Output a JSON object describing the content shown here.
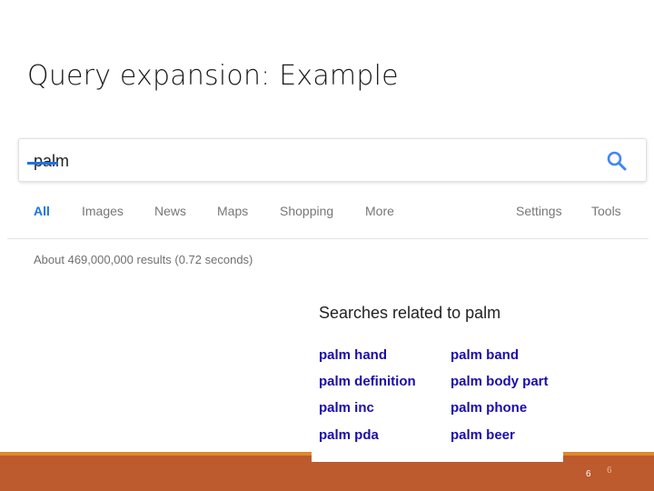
{
  "slide": {
    "title": "Query expansion: Example",
    "number": "6",
    "number_ghost": "6"
  },
  "search": {
    "query": "palm",
    "button_icon": "search-icon"
  },
  "tabs": [
    {
      "label": "All",
      "active": true
    },
    {
      "label": "Images"
    },
    {
      "label": "News"
    },
    {
      "label": "Maps"
    },
    {
      "label": "Shopping"
    },
    {
      "label": "More"
    },
    {
      "label": "Settings"
    },
    {
      "label": "Tools"
    }
  ],
  "results": {
    "stats": "About 469,000,000 results (0.72 seconds)"
  },
  "related": {
    "title": "Searches related to palm",
    "left": [
      "palm hand",
      "palm definition",
      "palm inc",
      "palm pda"
    ],
    "right": [
      "palm band",
      "palm body part",
      "palm phone",
      "palm beer"
    ]
  },
  "colors": {
    "accent": "#1a73e8",
    "link": "#1a0dab",
    "footer": "#bd5a2e",
    "footer_line": "#dd8a2a"
  }
}
